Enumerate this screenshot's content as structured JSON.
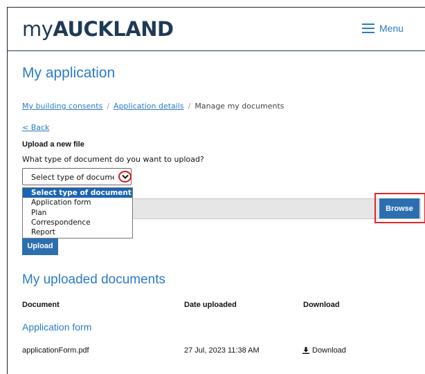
{
  "header": {
    "logo_prefix": "my",
    "logo_brand": "AUCKLAND",
    "menu_label": "Menu"
  },
  "page": {
    "title": "My application"
  },
  "breadcrumb": {
    "items": [
      "My building consents",
      "Application details"
    ],
    "current": "Manage my documents",
    "separator": "/"
  },
  "back_label": "< Back",
  "upload": {
    "heading": "Upload a new file",
    "question": "What type of document do you want to upload?",
    "select_value": "Select type of document",
    "options": [
      "Select type of document",
      "Application form",
      "Plan",
      "Correspondence",
      "Report"
    ],
    "browse_label": "Browse",
    "upload_label": "Upload"
  },
  "uploaded": {
    "heading": "My uploaded documents",
    "columns": [
      "Document",
      "Date uploaded",
      "Download"
    ],
    "group_title": "Application form",
    "rows": [
      {
        "file": "applicationForm.pdf",
        "date": "27 Jul, 2023 11:38 AM",
        "download": "Download"
      }
    ]
  },
  "colors": {
    "brand_blue": "#2c7bc4",
    "navy": "#1f3a56",
    "button_blue": "#2c6fb0",
    "highlight_red": "#e0262b"
  }
}
